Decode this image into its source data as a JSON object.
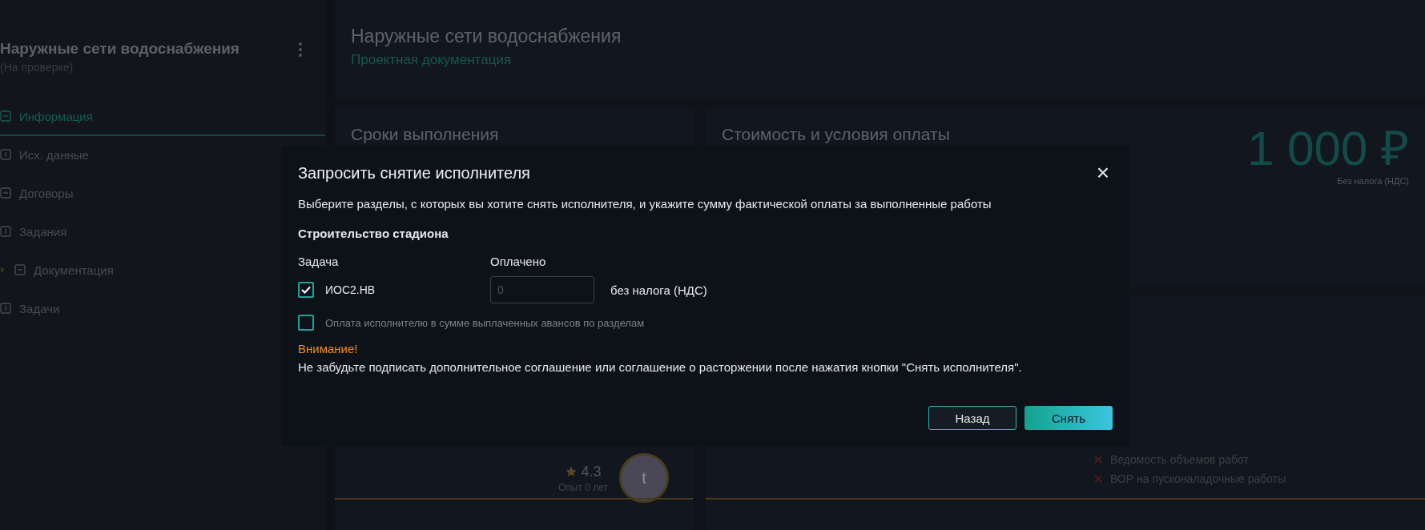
{
  "sidebar": {
    "title": "Наружные сети водоснабжения",
    "status": "(На проверке)",
    "menu_items": [
      {
        "label": "Информация",
        "selected": true,
        "kind": "item"
      },
      {
        "label": "Исх. данные",
        "selected": false,
        "kind": "item"
      },
      {
        "label": "Договоры",
        "selected": false,
        "kind": "item"
      },
      {
        "label": "Задания",
        "selected": false,
        "kind": "item"
      },
      {
        "label": "Документация",
        "selected": false,
        "kind": "group"
      },
      {
        "label": "Задачи",
        "selected": false,
        "kind": "item"
      }
    ]
  },
  "header": {
    "title": "Наружные сети водоснабжения",
    "subtitle": "Проектная документация"
  },
  "deadlines": {
    "title": "Сроки выполнения",
    "rating": "4.3",
    "experience": "Опыт 0 лет",
    "avatar_letter": "t"
  },
  "cost": {
    "title": "Стоимость и условия оплаты",
    "amount": "1 000 ₽",
    "tax_note": "Без налога (НДС)"
  },
  "documents": [
    {
      "label": "Ведомость объемов работ"
    },
    {
      "label": "ВОР на пусконаладочные работы"
    }
  ],
  "dialog": {
    "title": "Запросить снятие исполнителя",
    "close": "×",
    "description": "Выберите разделы, с которых вы хотите снять исполнителя, и укажите сумму фактической оплаты за выполненные работы",
    "section": "Строительство стадиона",
    "columns": [
      "Задача",
      "Оплачено"
    ],
    "rows": [
      {
        "task": "ИОС2.НВ",
        "checked": true,
        "paid_placeholder": "0",
        "unit": "без налога (НДС)"
      }
    ],
    "advance_option": {
      "label": "Оплата исполнителю в сумме выплаченных авансов по разделам",
      "checked": false
    },
    "warning": {
      "title": "Внимание!",
      "text": "Не забудьте подписать дополнительное соглашение или соглашение о расторжении после нажатия кнопки \"Снять исполнителя\"."
    },
    "buttons": [
      {
        "label": "Назад",
        "kind": "secondary"
      },
      {
        "label": "Снять",
        "kind": "primary"
      }
    ]
  }
}
